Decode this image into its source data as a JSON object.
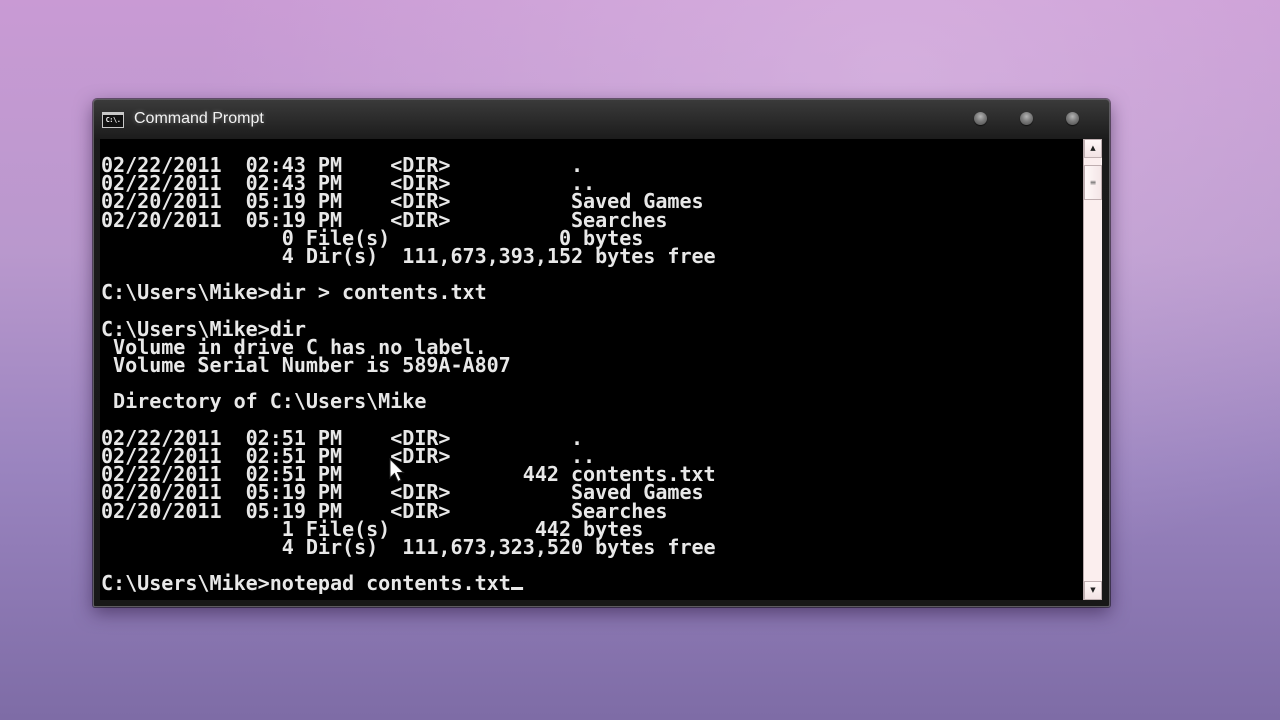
{
  "window": {
    "title": "Command Prompt",
    "icon_label": "C:\\.",
    "controls": [
      "minimize",
      "maximize",
      "close"
    ]
  },
  "console": {
    "lines": [
      "02/22/2011  02:43 PM    <DIR>          .",
      "02/22/2011  02:43 PM    <DIR>          ..",
      "02/20/2011  05:19 PM    <DIR>          Saved Games",
      "02/20/2011  05:19 PM    <DIR>          Searches",
      "               0 File(s)              0 bytes",
      "               4 Dir(s)  111,673,393,152 bytes free",
      "",
      "C:\\Users\\Mike>dir > contents.txt",
      "",
      "C:\\Users\\Mike>dir",
      " Volume in drive C has no label.",
      " Volume Serial Number is 589A-A807",
      "",
      " Directory of C:\\Users\\Mike",
      "",
      "02/22/2011  02:51 PM    <DIR>          .",
      "02/22/2011  02:51 PM    <DIR>          ..",
      "02/22/2011  02:51 PM               442 contents.txt",
      "02/20/2011  05:19 PM    <DIR>          Saved Games",
      "02/20/2011  05:19 PM    <DIR>          Searches",
      "               1 File(s)            442 bytes",
      "               4 Dir(s)  111,673,323,520 bytes free",
      ""
    ],
    "prompt": "C:\\Users\\Mike>",
    "current_input": "notepad contents.txt"
  },
  "scrollbar": {
    "up_arrow": "▲",
    "down_arrow": "▼",
    "thumb_grip": "≡",
    "position": 0.0
  },
  "colors": {
    "console_bg": "#000000",
    "console_text": "#e8e8e8",
    "desktop_top": "#c99ad4",
    "desktop_bottom": "#7e6ca6"
  }
}
